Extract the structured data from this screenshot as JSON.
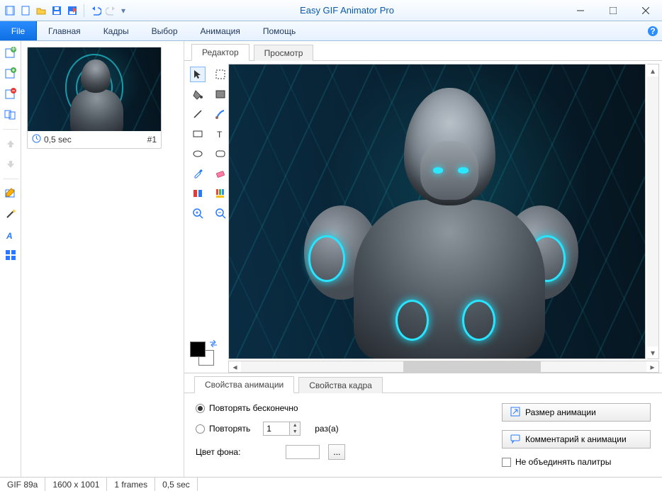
{
  "app": {
    "title": "Easy GIF Animator Pro"
  },
  "menu": {
    "file": "File",
    "items": [
      "Главная",
      "Кадры",
      "Выбор",
      "Анимация",
      "Помощь"
    ]
  },
  "leftTools": [
    "frame-add-icon",
    "frame-insert-icon",
    "frame-delete-icon",
    "frame-props-icon",
    "arrow-up-icon",
    "arrow-down-icon",
    "edit-icon",
    "wand-icon",
    "text-tool-icon",
    "grid-icon"
  ],
  "frame": {
    "duration": "0,5 sec",
    "index": "#1"
  },
  "editorTabs": {
    "editor": "Редактор",
    "preview": "Просмотр"
  },
  "editTools": [
    "pointer",
    "marquee",
    "fill",
    "rect-fill",
    "line",
    "brush",
    "rect",
    "text",
    "ellipse",
    "rounded",
    "eyedrop",
    "eraser",
    "flip",
    "palette",
    "zoom-in",
    "zoom-out"
  ],
  "propTabs": {
    "anim": "Свойства анимации",
    "frame": "Свойства кадра"
  },
  "props": {
    "repeatForever": "Повторять бесконечно",
    "repeat": "Повторять",
    "repeatCount": "1",
    "times": "раз(а)",
    "bgcolor": "Цвет фона:",
    "sizeBtn": "Размер анимации",
    "commentBtn": "Комментарий к анимации",
    "noMerge": "Не объединять палитры",
    "ellipsis": "..."
  },
  "status": {
    "format": "GIF 89a",
    "dims": "1600 x 1001",
    "frames": "1 frames",
    "duration": "0,5 sec"
  }
}
